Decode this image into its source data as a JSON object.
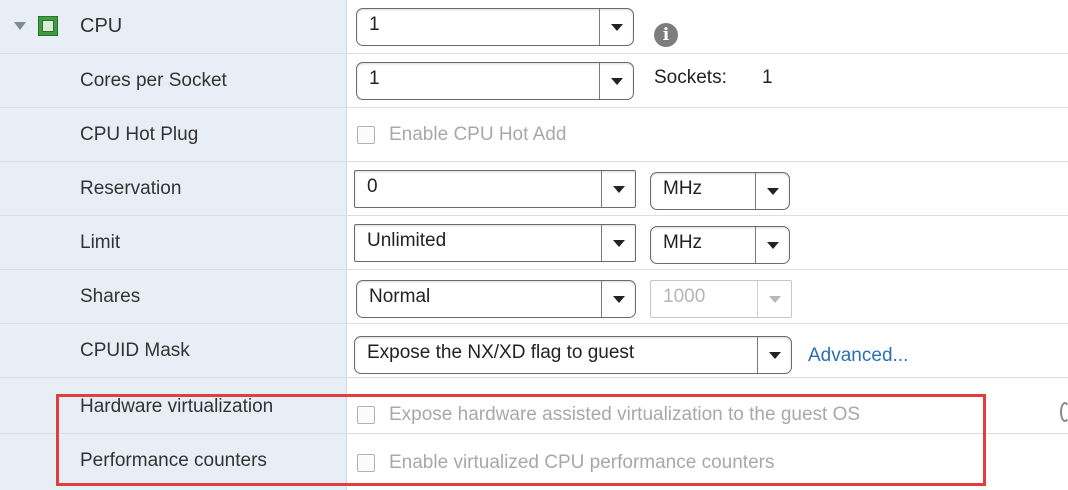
{
  "cpu": {
    "title": "CPU",
    "value": "1",
    "icon": "chip-icon",
    "expander_icon": "chevron-down-icon",
    "info_icon": "info-icon",
    "info_glyph": "i"
  },
  "cores_per_socket": {
    "label": "Cores per Socket",
    "value": "1",
    "sockets_label": "Sockets:",
    "sockets_value": "1"
  },
  "cpu_hot_plug": {
    "label": "CPU Hot Plug",
    "checkbox_label": "Enable CPU Hot Add",
    "checked": false
  },
  "reservation": {
    "label": "Reservation",
    "value": "0",
    "unit": "MHz"
  },
  "limit": {
    "label": "Limit",
    "value": "Unlimited",
    "unit": "MHz"
  },
  "shares": {
    "label": "Shares",
    "value": "Normal",
    "amount": "1000"
  },
  "cpuid_mask": {
    "label": "CPUID Mask",
    "value": "Expose the NX/XD flag to guest",
    "advanced_link": "Advanced..."
  },
  "hardware_virtualization": {
    "label": "Hardware virtualization",
    "checkbox_label": "Expose hardware assisted virtualization to the guest OS",
    "checked": false
  },
  "performance_counters": {
    "label": "Performance counters",
    "checkbox_label": "Enable virtualized CPU performance counters",
    "checked": false
  },
  "colors": {
    "label_column": "#e7eef5",
    "highlight": "#e0403b",
    "link": "#2a6fb3"
  }
}
